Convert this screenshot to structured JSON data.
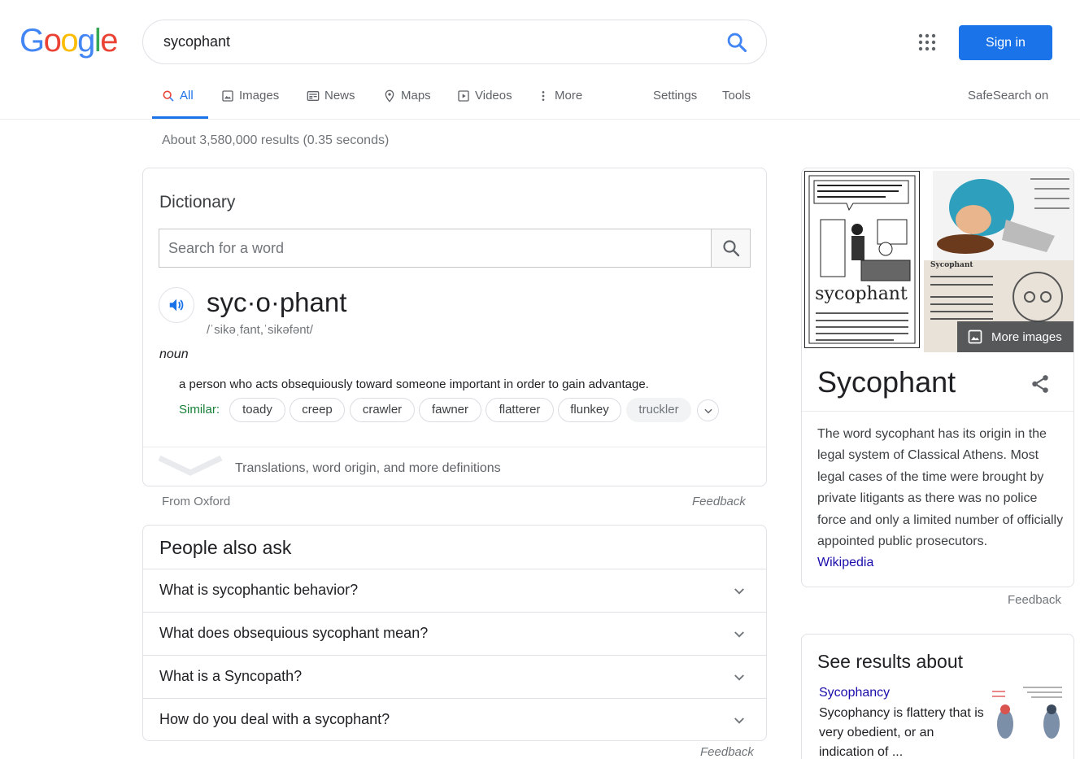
{
  "header": {
    "logo_letters": [
      "G",
      "o",
      "o",
      "g",
      "l",
      "e"
    ],
    "logo_colors": [
      "#4285F4",
      "#EA4335",
      "#FBBC05",
      "#4285F4",
      "#34A853",
      "#EA4335"
    ],
    "query": "sycophant",
    "signin_label": "Sign in"
  },
  "tabs": {
    "items": [
      {
        "label": "All",
        "icon": "search-icon"
      },
      {
        "label": "Images",
        "icon": "image-icon"
      },
      {
        "label": "News",
        "icon": "news-icon"
      },
      {
        "label": "Maps",
        "icon": "map-pin-icon"
      },
      {
        "label": "Videos",
        "icon": "video-icon"
      },
      {
        "label": "More",
        "icon": "more-vert-icon"
      }
    ],
    "settings": "Settings",
    "tools": "Tools",
    "safesearch": "SafeSearch on",
    "active_color": "#1a73e8"
  },
  "stats": "About 3,580,000 results (0.35 seconds)",
  "dictionary": {
    "title": "Dictionary",
    "search_placeholder": "Search for a word",
    "word": "syc·o·phant",
    "phonetic": "/ˈsikəˌfant,ˈsikəfənt/",
    "part_of_speech": "noun",
    "definition": "a person who acts obsequiously toward someone important in order to gain advantage.",
    "similar_label": "Similar:",
    "similar": [
      "toady",
      "creep",
      "crawler",
      "fawner",
      "flatterer",
      "flunkey",
      "truckler"
    ],
    "more_definitions": "Translations, word origin, and more definitions",
    "source": "From Oxford",
    "feedback": "Feedback"
  },
  "people_also_ask": {
    "title": "People also ask",
    "questions": [
      "What is sycophantic behavior?",
      "What does obsequious sycophant mean?",
      "What is a Syncopath?",
      "How do you deal with a sycophant?"
    ],
    "feedback": "Feedback"
  },
  "knowledge_panel": {
    "title": "Sycophant",
    "description": "The word sycophant has its origin in the legal system of Classical Athens. Most legal cases of the time were brought by private litigants as there was no police force and only a limited number of officially appointed public prosecutors.",
    "source_link": "Wikipedia",
    "more_images": "More images",
    "feedback": "Feedback",
    "image_caption_1": "sycophant",
    "image_caption_2": "Sycophant"
  },
  "see_results_about": {
    "title": "See results about",
    "link": "Sycophancy",
    "text": "Sycophancy is flattery that is very obedient, or an indication of ..."
  }
}
